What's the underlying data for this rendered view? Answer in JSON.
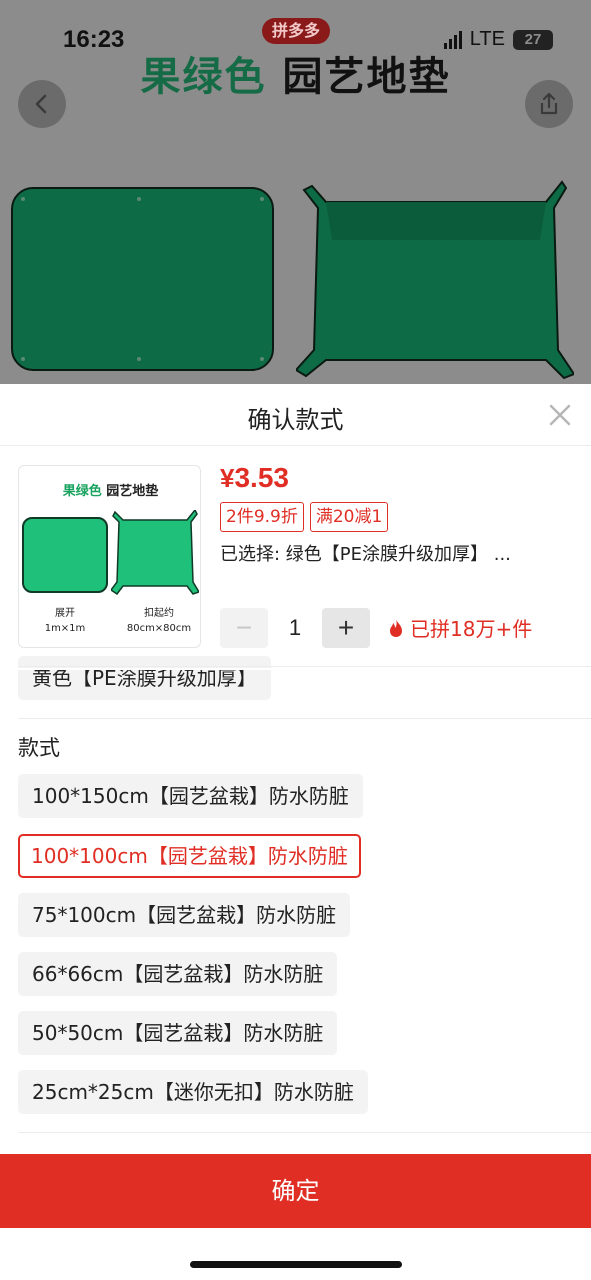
{
  "status_bar": {
    "time": "16:23",
    "network": "LTE",
    "battery": "27"
  },
  "banner": {
    "brand_badge": "拼多多",
    "title_color_word": "果绿色",
    "title_rest": "园艺地垫"
  },
  "sheet": {
    "title": "确认款式",
    "product": {
      "thumb_title_color": "果绿色",
      "thumb_title_rest": "园艺地垫",
      "caption_left_1": "展开",
      "caption_left_2": "1m×1m",
      "caption_right_1": "扣起约",
      "caption_right_2": "80cm×80cm",
      "currency": "¥",
      "price": "3.53",
      "promos": [
        "2件9.9折",
        "满20减1"
      ],
      "selected_text": "已选择: 绿色【PE涂膜升级加厚】 ...",
      "quantity": "1",
      "minus_label": "−",
      "plus_label": "+",
      "sold_text": "已拼18万+件"
    },
    "color_option_partial": "黄色【PE涂膜升级加厚】",
    "style_section_label": "款式",
    "style_options": [
      "100*150cm【园艺盆栽】防水防脏",
      "100*100cm【园艺盆栽】防水防脏",
      "75*100cm【园艺盆栽】防水防脏",
      "66*66cm【园艺盆栽】防水防脏",
      "50*50cm【园艺盆栽】防水防脏",
      "25cm*25cm【迷你无扣】防水防脏"
    ],
    "selected_style_index": 1,
    "confirm_label": "确定"
  },
  "colors": {
    "accent_red": "#e02e24",
    "mat_green": "#1fc07a",
    "option_bg": "#f3f3f3"
  }
}
